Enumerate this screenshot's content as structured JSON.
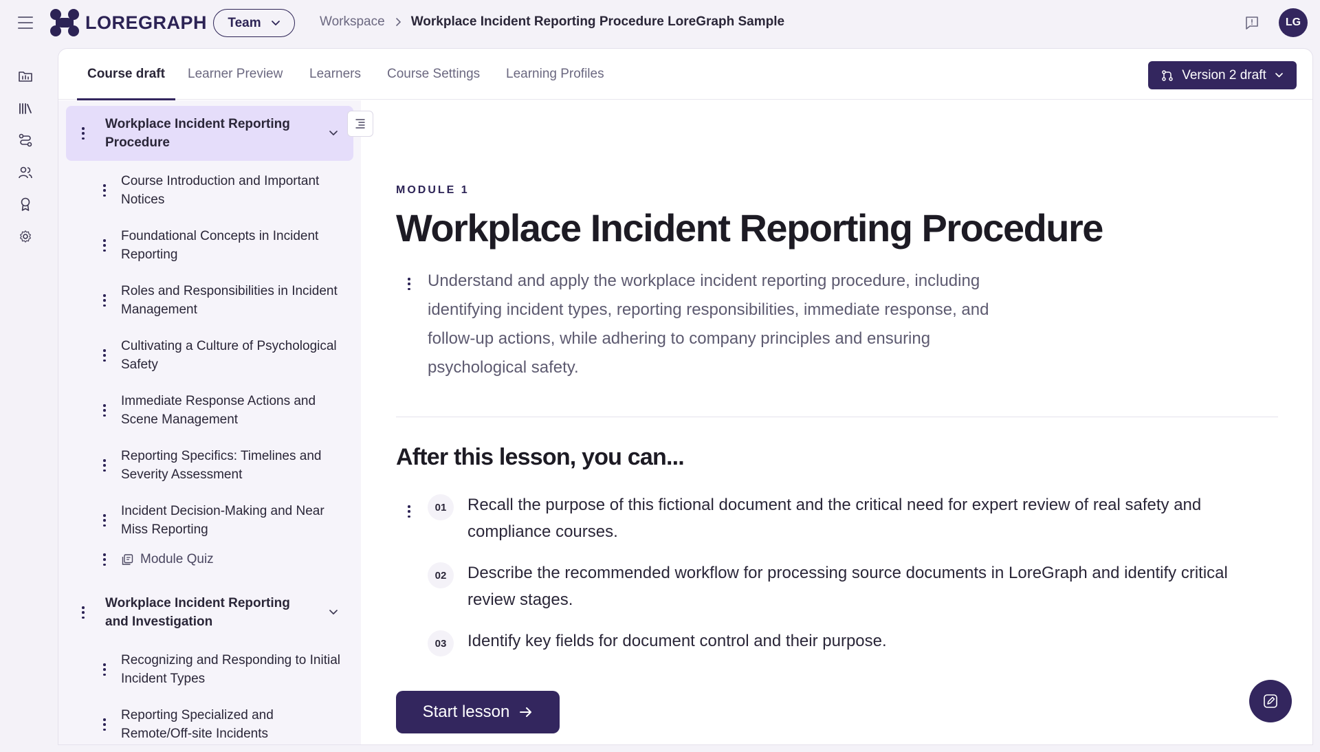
{
  "header": {
    "logo_text": "LOREGRAPH",
    "team_label": "Team",
    "breadcrumb_parent": "Workspace",
    "breadcrumb_current": "Workplace Incident Reporting Procedure LoreGraph Sample",
    "avatar_initials": "LG"
  },
  "rail": {
    "items": [
      "courses-icon",
      "library-icon",
      "pathways-icon",
      "users-icon",
      "badge-icon",
      "settings-icon"
    ]
  },
  "tabs": [
    "Course draft",
    "Learner Preview",
    "Learners",
    "Course Settings",
    "Learning Profiles"
  ],
  "version_label": "Version 2 draft",
  "sidebar": {
    "modules": [
      {
        "title": "Workplace Incident Reporting Procedure",
        "lessons": [
          "Course Introduction and Important Notices",
          "Foundational Concepts in Incident Reporting",
          "Roles and Responsibilities in Incident Management",
          "Cultivating a Culture of Psychological Safety",
          "Immediate Response Actions and Scene Management",
          "Reporting Specifics: Timelines and Severity Assessment",
          "Incident Decision-Making and Near Miss Reporting"
        ],
        "quiz": "Module Quiz"
      },
      {
        "title": "Workplace Incident Reporting and Investigation",
        "lessons": [
          "Recognizing and Responding to Initial Incident Types",
          "Reporting Specialized and Remote/Off-site Incidents"
        ]
      }
    ]
  },
  "main": {
    "eyebrow": "MODULE 1",
    "title": "Workplace Incident Reporting Procedure",
    "description": "Understand and apply the workplace incident reporting procedure, including identifying incident types, reporting responsibilities, immediate response, and follow-up actions, while adhering to company principles and ensuring psychological safety.",
    "objectives_heading": "After this lesson, you can...",
    "objectives": [
      {
        "num": "01",
        "text": "Recall the purpose of this fictional document and the critical need for expert review of real safety and compliance courses."
      },
      {
        "num": "02",
        "text": "Describe the recommended workflow for processing source documents in LoreGraph and identify critical review stages."
      },
      {
        "num": "03",
        "text": "Identify key fields for document control and their purpose."
      }
    ],
    "start_label": "Start lesson"
  },
  "colors": {
    "brand": "#33265e",
    "active_module_bg": "#e5ddfa",
    "sidebar_bg": "#f6f4fa"
  }
}
